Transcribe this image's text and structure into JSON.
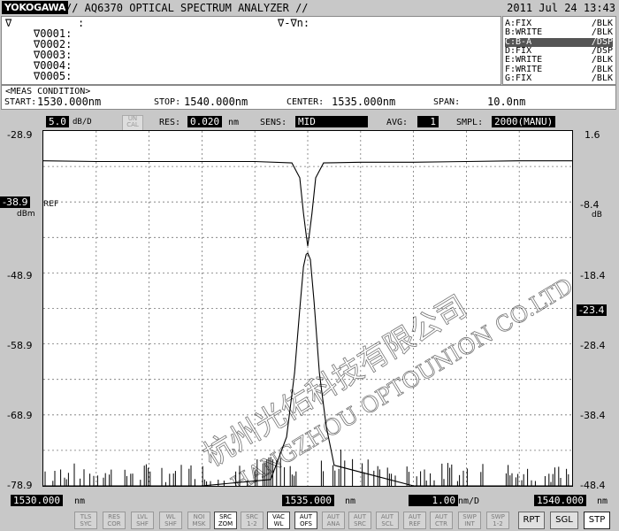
{
  "header": {
    "logo": "YOKOGAWA",
    "title": "// AQ6370 OPTICAL SPECTRUM ANALYZER //",
    "datetime": "2011 Jul 24 13:43"
  },
  "markers": {
    "main_label": "∇",
    "main_value": ":",
    "delta_header": "∇-∇n:",
    "items": [
      "∇0001:",
      "∇0002:",
      "∇0003:",
      "∇0004:",
      "∇0005:"
    ]
  },
  "traces": [
    {
      "name": "A:FIX",
      "mode": "/BLK",
      "active": false
    },
    {
      "name": "B:WRITE",
      "mode": "/BLK",
      "active": false
    },
    {
      "name": "C:B-A",
      "mode": "/DSP",
      "active": true
    },
    {
      "name": "D:FIX",
      "mode": "/DSP",
      "active": false
    },
    {
      "name": "E:WRITE",
      "mode": "/BLK",
      "active": false
    },
    {
      "name": "F:WRITE",
      "mode": "/BLK",
      "active": false
    },
    {
      "name": "G:FIX",
      "mode": "/BLK",
      "active": false
    }
  ],
  "meas": {
    "header": "<MEAS CONDITION>",
    "start_label": "START:",
    "start": "1530.000nm",
    "stop_label": "STOP:",
    "stop": "1540.000nm",
    "center_label": "CENTER:",
    "center": "1535.000nm",
    "span_label": "SPAN:",
    "span": "10.0nm"
  },
  "settings": {
    "scale": "5.0",
    "scale_unit": "dB/D",
    "uncal_1": "UN",
    "uncal_2": "CAL",
    "res_label": "RES:",
    "res": "0.020",
    "res_unit": "nm",
    "sens_label": "SENS:",
    "sens": "MID",
    "avg_label": "AVG:",
    "avg": "1",
    "smpl_label": "SMPL:",
    "smpl": "2000(MANU)"
  },
  "axes": {
    "left_ticks": [
      "-28.9",
      "-38.9",
      "-48.9",
      "-58.9",
      "-68.9",
      "-78.9"
    ],
    "ref_value": "-38.9",
    "ref_label": "REF",
    "left_unit": "dBm",
    "right_ticks": [
      "1.6",
      "-8.4",
      "-18.4",
      "-28.4",
      "-38.4",
      "-48.4"
    ],
    "right_unit": "dB",
    "right_marker": "-23.4",
    "x_start": "1530.000",
    "x_center": "1535.000",
    "x_stop": "1540.000",
    "x_unit": "nm",
    "x_div": "1.00",
    "x_div_unit": "nm/D"
  },
  "watermark": {
    "line1": "杭州光佑科技有限公司",
    "line2": "HANGZHOU OPTOUNION CO.LTD"
  },
  "softkeys": [
    {
      "top": "TLS",
      "bottom": "SYC",
      "on": false
    },
    {
      "top": "RES",
      "bottom": "COR",
      "on": false
    },
    {
      "top": "LVL",
      "bottom": "SHF",
      "on": false
    },
    {
      "top": "WL",
      "bottom": "SHF",
      "on": false
    },
    {
      "top": "NOI",
      "bottom": "MSK",
      "on": false
    },
    {
      "top": "SRC",
      "bottom": "ZOM",
      "on": true
    },
    {
      "top": "SRC",
      "bottom": "1-2",
      "on": false
    },
    {
      "top": "VAC",
      "bottom": "WL",
      "on": true
    },
    {
      "top": "AUT",
      "bottom": "OFS",
      "on": true
    },
    {
      "top": "AUT",
      "bottom": "ANA",
      "on": false
    },
    {
      "top": "AUT",
      "bottom": "SRC",
      "on": false
    },
    {
      "top": "AUT",
      "bottom": "SCL",
      "on": false
    },
    {
      "top": "AUT",
      "bottom": "REF",
      "on": false
    },
    {
      "top": "AUT",
      "bottom": "CTR",
      "on": false
    },
    {
      "top": "SWP",
      "bottom": "INT",
      "on": false
    },
    {
      "top": "SWP",
      "bottom": "1-2",
      "on": false
    }
  ],
  "bigkeys": [
    "RPT",
    "SGL",
    "STP"
  ],
  "chart_data": {
    "type": "line",
    "xlim": [
      1530.0,
      1540.0
    ],
    "ylim": [
      -78.9,
      -28.9
    ],
    "y_right_lim": [
      -48.4,
      1.6
    ],
    "grid": true,
    "series": [
      {
        "axis": "left",
        "x": [
          1530.0,
          1531.0,
          1532.0,
          1533.0,
          1534.0,
          1534.7,
          1534.85,
          1534.92,
          1534.97,
          1535.0,
          1535.03,
          1535.08,
          1535.15,
          1535.3,
          1536.0,
          1537.0,
          1538.0,
          1539.0,
          1540.0
        ],
        "y": [
          -33.1,
          -33.2,
          -33.2,
          -33.2,
          -33.2,
          -33.4,
          -35.5,
          -40.5,
          -43.5,
          -45.1,
          -43.5,
          -40.5,
          -35.5,
          -33.4,
          -33.3,
          -33.3,
          -33.2,
          -33.1,
          -33.1
        ]
      },
      {
        "axis": "left",
        "x": [
          1530.0,
          1533.0,
          1534.3,
          1534.6,
          1534.75,
          1534.85,
          1534.92,
          1534.97,
          1535.0,
          1535.05,
          1535.12,
          1535.22,
          1535.35,
          1535.5,
          1537.0,
          1540.0
        ],
        "y": [
          -78.9,
          -78.9,
          -78.0,
          -72.0,
          -63.0,
          -54.0,
          -48.0,
          -46.3,
          -46.1,
          -47.0,
          -53.0,
          -63.0,
          -70.5,
          -76.0,
          -78.9,
          -78.9
        ]
      }
    ]
  }
}
